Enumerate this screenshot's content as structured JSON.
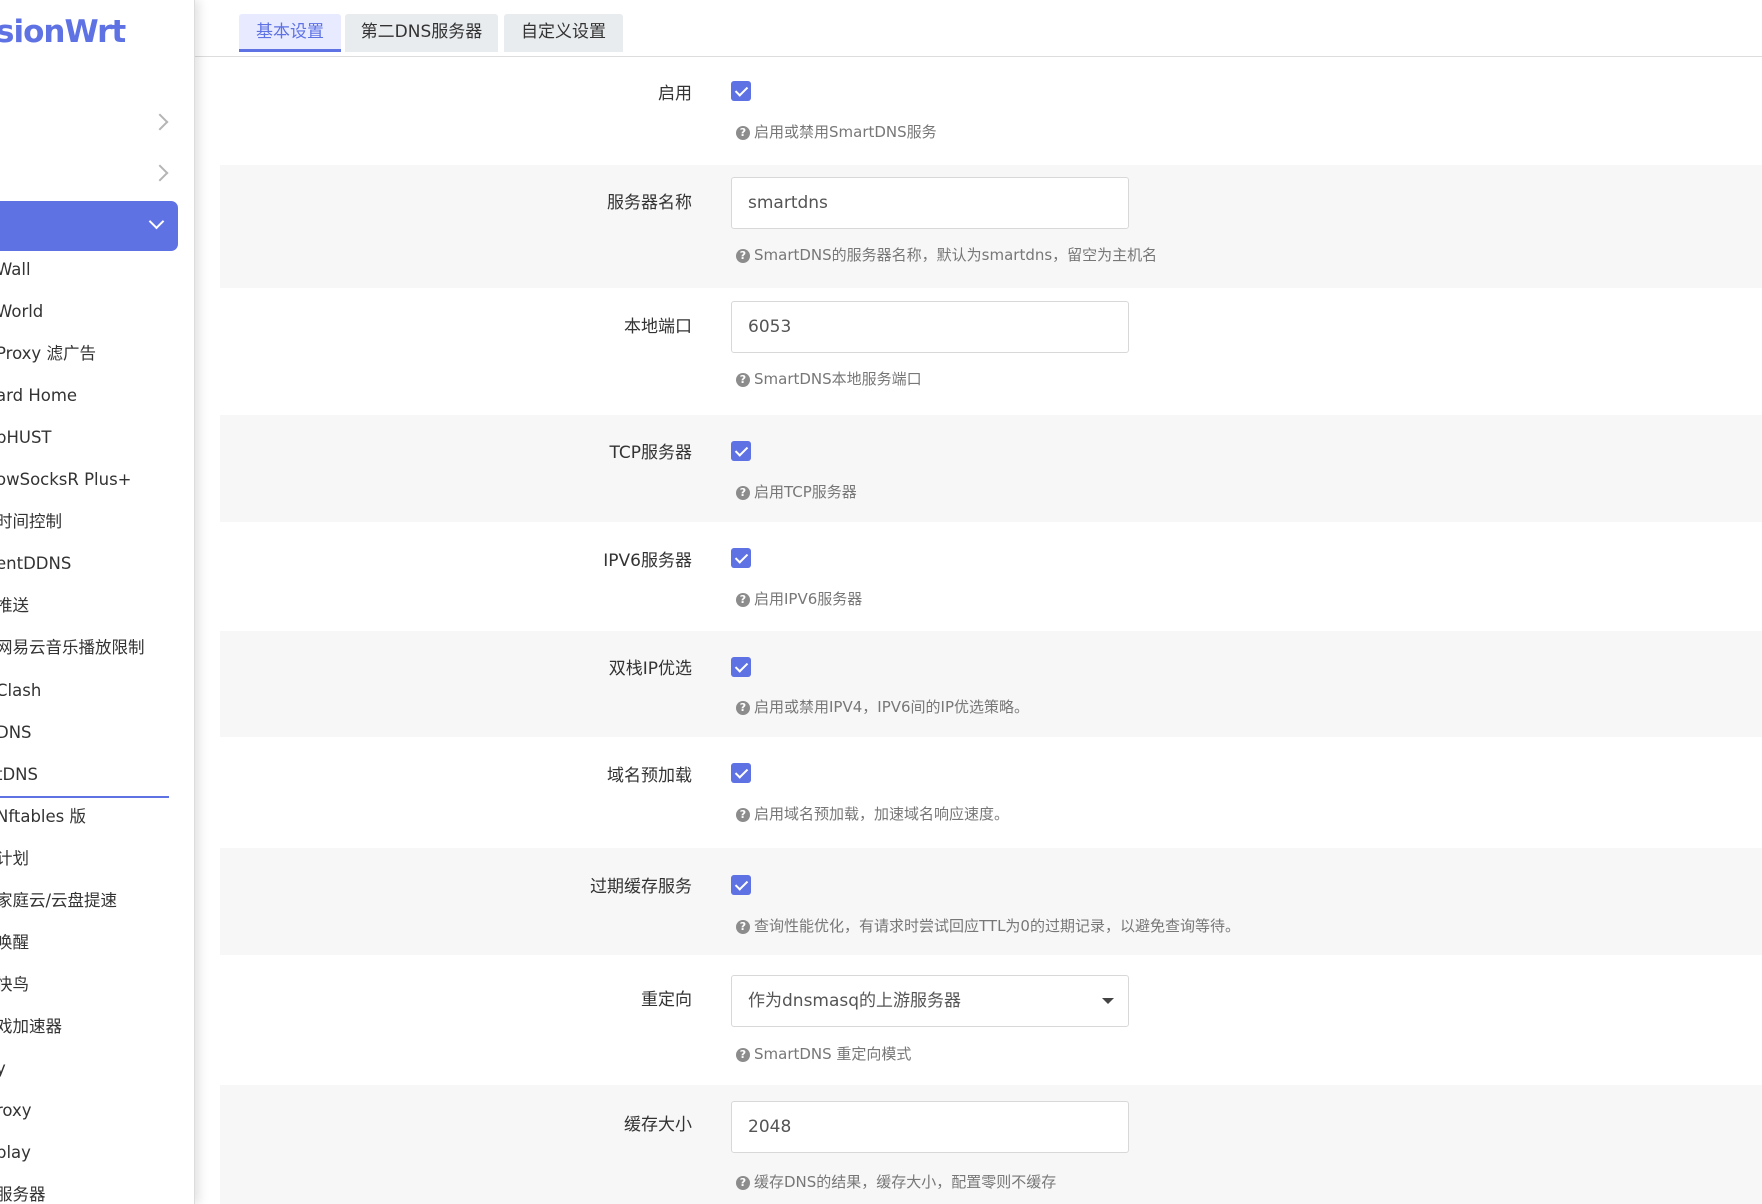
{
  "brand": {
    "logo_text": "sionWrt",
    "accent_color": "#5e72e4"
  },
  "sidebar": {
    "submenu": [
      "Wall",
      "World",
      "Proxy 滤广告",
      "ard Home",
      "pHUST",
      "owSocksR Plus+",
      "时间控制",
      "entDDNS",
      "推送",
      "网易云音乐播放限制",
      " Clash",
      "DNS",
      "tDNS",
      "Nftables 版",
      "计划",
      "家庭云/云盘提速",
      "唤醒",
      "快鸟",
      "戏加速器",
      "y",
      "roxy",
      "play",
      "服务器"
    ],
    "active_index": 12
  },
  "tabs": [
    {
      "label": "基本设置",
      "active": true
    },
    {
      "label": "第二DNS服务器",
      "active": false
    },
    {
      "label": "自定义设置",
      "active": false
    }
  ],
  "form": {
    "enable": {
      "label": "启用",
      "checked": true,
      "hint": "启用或禁用SmartDNS服务"
    },
    "server_name": {
      "label": "服务器名称",
      "value": "smartdns",
      "hint": "SmartDNS的服务器名称，默认为smartdns，留空为主机名"
    },
    "local_port": {
      "label": "本地端口",
      "value": "6053",
      "hint": "SmartDNS本地服务端口"
    },
    "tcp_server": {
      "label": "TCP服务器",
      "checked": true,
      "hint": "启用TCP服务器"
    },
    "ipv6_server": {
      "label": "IPV6服务器",
      "checked": true,
      "hint": "启用IPV6服务器"
    },
    "dualstack": {
      "label": "双栈IP优选",
      "checked": true,
      "hint": "启用或禁用IPV4，IPV6间的IP优选策略。"
    },
    "prefetch": {
      "label": "域名预加载",
      "checked": true,
      "hint": "启用域名预加载，加速域名响应速度。"
    },
    "serve_expired": {
      "label": "过期缓存服务",
      "checked": true,
      "hint": "查询性能优化，有请求时尝试回应TTL为0的过期记录，以避免查询等待。"
    },
    "redirect": {
      "label": "重定向",
      "value": "作为dnsmasq的上游服务器",
      "hint": "SmartDNS 重定向模式"
    },
    "cache_size": {
      "label": "缓存大小",
      "value": "2048",
      "hint": "缓存DNS的结果，缓存大小，配置零则不缓存"
    }
  }
}
